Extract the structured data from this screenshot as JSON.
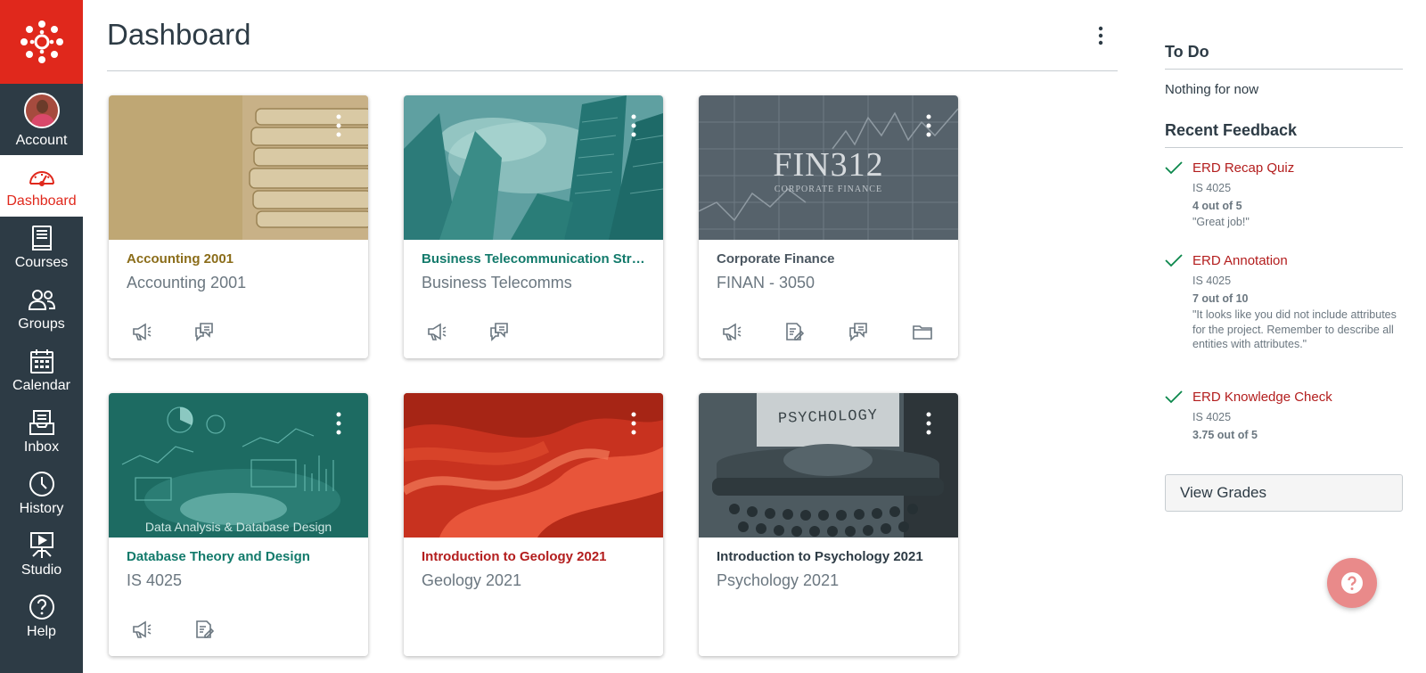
{
  "nav": {
    "items": [
      {
        "label": "Account",
        "icon": "avatar"
      },
      {
        "label": "Dashboard",
        "icon": "dashboard-icon"
      },
      {
        "label": "Courses",
        "icon": "courses-icon"
      },
      {
        "label": "Groups",
        "icon": "groups-icon"
      },
      {
        "label": "Calendar",
        "icon": "calendar-icon"
      },
      {
        "label": "Inbox",
        "icon": "inbox-icon"
      },
      {
        "label": "History",
        "icon": "history-icon"
      },
      {
        "label": "Studio",
        "icon": "studio-icon"
      },
      {
        "label": "Help",
        "icon": "help-icon"
      }
    ],
    "active": "Dashboard"
  },
  "page": {
    "title": "Dashboard"
  },
  "cards": [
    {
      "title": "Accounting 2001",
      "subtitle": "Accounting 2001",
      "color": "#8b6d1a",
      "actions": [
        "announcements-icon",
        "discussions-icon"
      ]
    },
    {
      "title": "Business Telecommunication Strategies",
      "subtitle": "Business Telecomms",
      "color": "#127a6b",
      "actions": [
        "announcements-icon",
        "discussions-icon"
      ]
    },
    {
      "title": "Corporate Finance",
      "subtitle": "FINAN - 3050",
      "color": "#4b5761",
      "image_text": {
        "main": "FIN312",
        "sub": "CORPORATE FINANCE"
      },
      "actions": [
        "announcements-icon",
        "assignments-icon",
        "discussions-icon",
        "files-icon"
      ]
    },
    {
      "title": "Database Theory and Design",
      "subtitle": "IS 4025",
      "color": "#127a6b",
      "image_text": {
        "main": "Data Analysis & Database Design"
      },
      "actions": [
        "announcements-icon",
        "assignments-icon"
      ]
    },
    {
      "title": "Introduction to Geology 2021",
      "subtitle": "Geology 2021",
      "color": "#b31d1d",
      "actions": []
    },
    {
      "title": "Introduction to Psychology 2021",
      "subtitle": "Psychology 2021",
      "color": "#2d3b45",
      "image_text": {
        "main": "PSYCHOLOGY"
      },
      "actions": []
    }
  ],
  "todo": {
    "heading": "To Do",
    "empty_text": "Nothing for now"
  },
  "feedback": {
    "heading": "Recent Feedback",
    "items": [
      {
        "title": "ERD Recap Quiz",
        "course": "IS 4025",
        "score": "4 out of 5",
        "comment": "\"Great job!\""
      },
      {
        "title": "ERD Annotation",
        "course": "IS 4025",
        "score": "7 out of 10",
        "comment": "\"It looks like you did not include attributes for the project. Remember to describe all entities with attributes.\""
      },
      {
        "title": "ERD Knowledge Check",
        "course": "IS 4025",
        "score": "3.75 out of 5",
        "comment": ""
      }
    ]
  },
  "view_grades_label": "View Grades",
  "colors": {
    "brand": "#e0281c",
    "nav_bg": "#2d3b45",
    "link_red": "#b31d1d",
    "help_fab": "#e98a8a"
  }
}
